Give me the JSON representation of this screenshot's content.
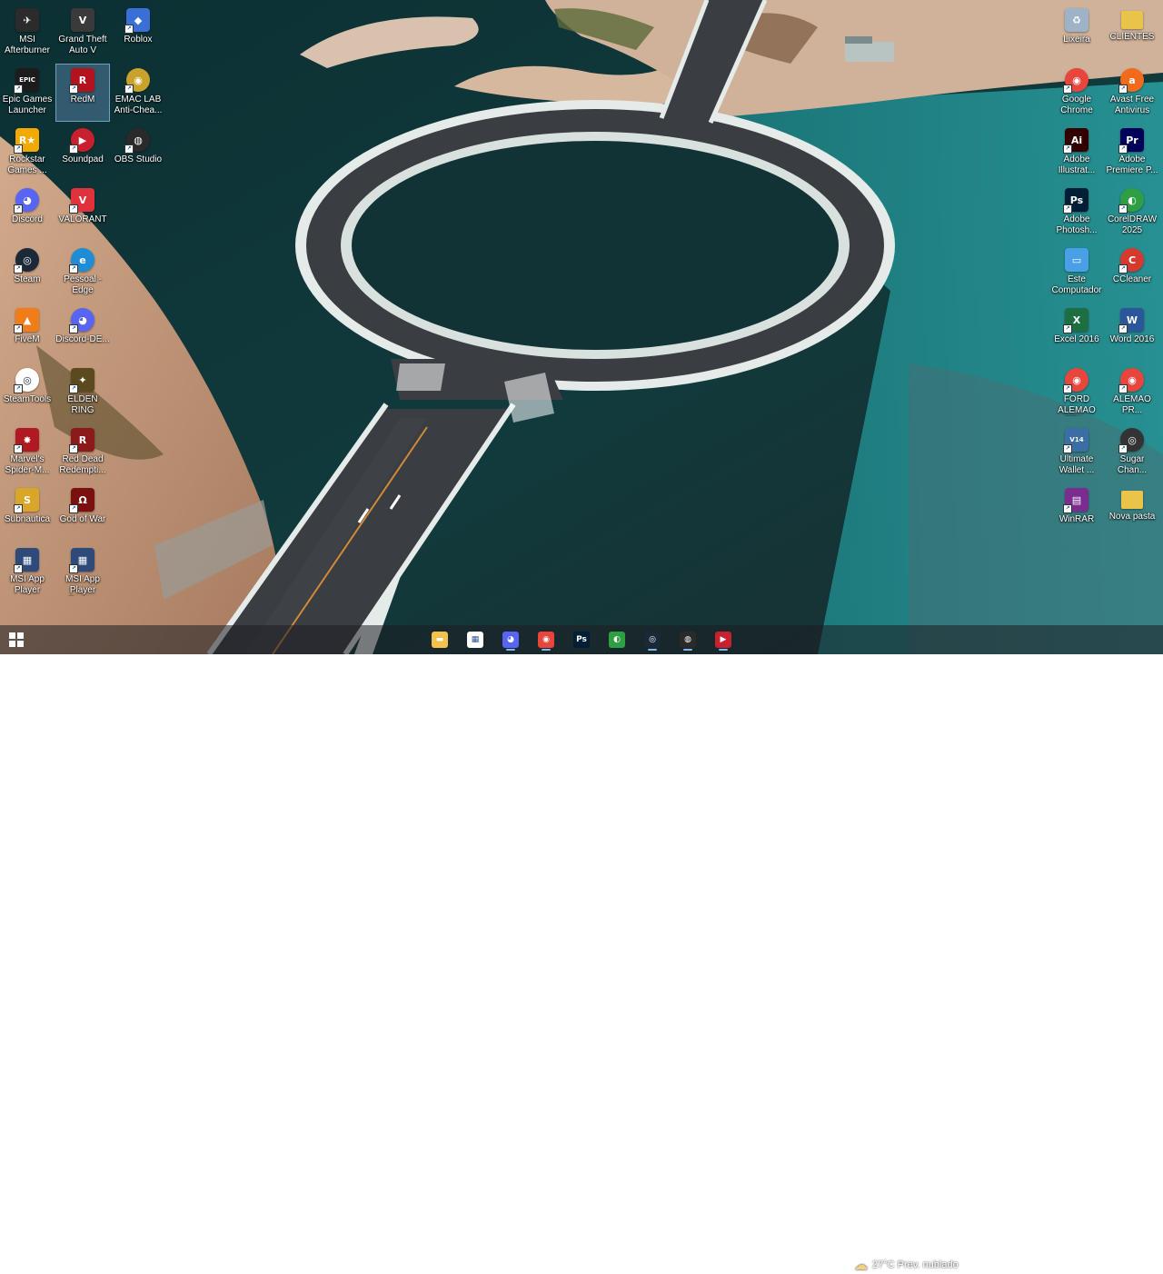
{
  "desktop": {
    "icons": [
      {
        "label": "MSI Afterburner",
        "icon": "msi-afterburner-icon",
        "color": "#2b2b2b",
        "glyph": "✈",
        "round": false
      },
      {
        "label": "Grand Theft Auto V",
        "icon": "gta-v-icon",
        "color": "#3a3a3a",
        "glyph": "V",
        "round": false
      },
      {
        "label": "Roblox",
        "icon": "roblox-icon",
        "color": "#3b6fd8",
        "glyph": "◆",
        "round": false
      },
      {
        "label": "Epic Games Launcher",
        "icon": "epic-games-icon",
        "color": "#1c1c1c",
        "glyph": "EPIC",
        "round": false
      },
      {
        "label": "RedM",
        "icon": "redm-icon",
        "color": "#b3121f",
        "glyph": "R",
        "round": false
      },
      {
        "label": "EMAC LAB Anti-Chea...",
        "icon": "emac-lab-icon",
        "color": "#c9a22b",
        "glyph": "◉",
        "round": true
      },
      {
        "label": "Rockstar Games ...",
        "icon": "rockstar-icon",
        "color": "#f2a900",
        "glyph": "R★",
        "round": false
      },
      {
        "label": "Soundpad",
        "icon": "soundpad-icon",
        "color": "#c8202f",
        "glyph": "▶",
        "round": true
      },
      {
        "label": "OBS Studio",
        "icon": "obs-icon",
        "color": "#2a2a2a",
        "glyph": "◍",
        "round": true
      },
      {
        "label": "Discord",
        "icon": "discord-icon",
        "color": "#5865f2",
        "glyph": "◕",
        "round": true
      },
      {
        "label": "VALORANT",
        "icon": "valorant-icon",
        "color": "#e0323c",
        "glyph": "V",
        "round": false
      },
      {
        "label": "Steam",
        "icon": "steam-icon",
        "color": "#1b2838",
        "glyph": "◎",
        "round": true
      },
      {
        "label": "Pessoal - Edge",
        "icon": "edge-icon",
        "color": "#1e8dd6",
        "glyph": "e",
        "round": true
      },
      {
        "label": "FiveM",
        "icon": "fivem-icon",
        "color": "#f07d1a",
        "glyph": "▲",
        "round": false
      },
      {
        "label": "Discord-DE...",
        "icon": "discord-dev-icon",
        "color": "#5865f2",
        "glyph": "◕",
        "round": true
      },
      {
        "label": "SteamTools",
        "icon": "steamtools-icon",
        "color": "#ffffff",
        "glyph": "◎",
        "round": true
      },
      {
        "label": "ELDEN RING",
        "icon": "elden-ring-icon",
        "color": "#5a4a1e",
        "glyph": "✦",
        "round": false
      },
      {
        "label": "Marvel's Spider-M...",
        "icon": "spiderman-icon",
        "color": "#b01822",
        "glyph": "✸",
        "round": false
      },
      {
        "label": "Red Dead Redempti...",
        "icon": "red-dead-icon",
        "color": "#8c1a1a",
        "glyph": "R",
        "round": false
      },
      {
        "label": "Subnautica",
        "icon": "subnautica-icon",
        "color": "#d9a62a",
        "glyph": "S",
        "round": false
      },
      {
        "label": "God of War",
        "icon": "god-of-war-icon",
        "color": "#7a1010",
        "glyph": "Ω",
        "round": false
      },
      {
        "label": "MSI App Player",
        "icon": "msi-app-player-icon",
        "color": "#2e4a7a",
        "glyph": "▦",
        "round": false
      },
      {
        "label": "MSI App Player Engine",
        "icon": "msi-app-player-engine-icon",
        "color": "#2e4a7a",
        "glyph": "▦",
        "round": false
      },
      {
        "label": "Lixeira",
        "icon": "recycle-bin-icon",
        "color": "#9fb3c8",
        "glyph": "♻",
        "round": false
      },
      {
        "label": "CLIENTES",
        "icon": "folder-icon",
        "color": "#e9c34a",
        "glyph": "",
        "round": false
      },
      {
        "label": "Google Chrome",
        "icon": "chrome-icon",
        "color": "#e8453c",
        "glyph": "◉",
        "round": true
      },
      {
        "label": "Avast Free Antivirus",
        "icon": "avast-icon",
        "color": "#f26b1d",
        "glyph": "a",
        "round": true
      },
      {
        "label": "Adobe Illustrat...",
        "icon": "illustrator-icon",
        "color": "#330000",
        "glyph": "Ai",
        "round": false
      },
      {
        "label": "Adobe Premiere P...",
        "icon": "premiere-icon",
        "color": "#00005b",
        "glyph": "Pr",
        "round": false
      },
      {
        "label": "Adobe Photosh...",
        "icon": "photoshop-icon",
        "color": "#001e36",
        "glyph": "Ps",
        "round": false
      },
      {
        "label": "CorelDRAW 2025",
        "icon": "coreldraw-icon",
        "color": "#2ea043",
        "glyph": "◐",
        "round": true
      },
      {
        "label": "Este Computador",
        "icon": "this-pc-icon",
        "color": "#4aa0e6",
        "glyph": "▭",
        "round": false
      },
      {
        "label": "CCleaner",
        "icon": "ccleaner-icon",
        "color": "#d63a2f",
        "glyph": "C",
        "round": true
      },
      {
        "label": "Excel 2016",
        "icon": "excel-icon",
        "color": "#1d6f42",
        "glyph": "X",
        "round": false
      },
      {
        "label": "Word 2016",
        "icon": "word-icon",
        "color": "#2b579a",
        "glyph": "W",
        "round": false
      },
      {
        "label": "FORD ALEMAO PRI...",
        "icon": "chrome-shortcut-icon",
        "color": "#e8453c",
        "glyph": "◉",
        "round": true
      },
      {
        "label": "ALEMAO PR...",
        "icon": "chrome-shortcut-2-icon",
        "color": "#e8453c",
        "glyph": "◉",
        "round": true
      },
      {
        "label": "Ultimate Wallet ...",
        "icon": "wallet-icon",
        "color": "#3a6ea5",
        "glyph": "V14",
        "round": false
      },
      {
        "label": "Sugar Chan...",
        "icon": "generic-app-icon",
        "color": "#333333",
        "glyph": "◎",
        "round": true
      },
      {
        "label": "WinRAR",
        "icon": "winrar-icon",
        "color": "#7b2d8f",
        "glyph": "▤",
        "round": false
      },
      {
        "label": "Nova pasta",
        "icon": "folder-2-icon",
        "color": "#e9c34a",
        "glyph": "",
        "round": false
      }
    ]
  },
  "taskbar": {
    "start_icon": "windows-start-icon",
    "apps": [
      {
        "name": "file-explorer-icon",
        "color": "#f2c24c",
        "glyph": "▬",
        "active": false
      },
      {
        "name": "microsoft-store-icon",
        "color": "#ffffff",
        "glyph": "▦",
        "active": false
      },
      {
        "name": "discord-taskbar-icon",
        "color": "#5865f2",
        "glyph": "◕",
        "active": true
      },
      {
        "name": "chrome-taskbar-icon",
        "color": "#e8453c",
        "glyph": "◉",
        "active": true
      },
      {
        "name": "photoshop-taskbar-icon",
        "color": "#001e36",
        "glyph": "Ps",
        "active": false
      },
      {
        "name": "coreldraw-taskbar-icon",
        "color": "#2ea043",
        "glyph": "◐",
        "active": false
      },
      {
        "name": "steam-taskbar-icon",
        "color": "#1b2838",
        "glyph": "◎",
        "active": true
      },
      {
        "name": "obs-taskbar-icon",
        "color": "#2a2a2a",
        "glyph": "◍",
        "active": true
      },
      {
        "name": "soundpad-taskbar-icon",
        "color": "#c8202f",
        "glyph": "▶",
        "active": true
      }
    ],
    "weather": {
      "icon": "partly-cloudy-icon",
      "text": "27°C  Prev. nublado"
    },
    "tray": [
      {
        "name": "tray-chevron-icon",
        "glyph": "^"
      },
      {
        "name": "network-icon",
        "glyph": "◠"
      },
      {
        "name": "volume-icon",
        "glyph": "♪"
      },
      {
        "name": "notification-icon",
        "glyph": "▭"
      }
    ]
  },
  "colors": {
    "water_dark": "#0e2a2c",
    "water_teal": "#1f8c8f",
    "sand": "#c79a7a",
    "bridge": "#e4ebe9",
    "road": "#3a3d41"
  }
}
